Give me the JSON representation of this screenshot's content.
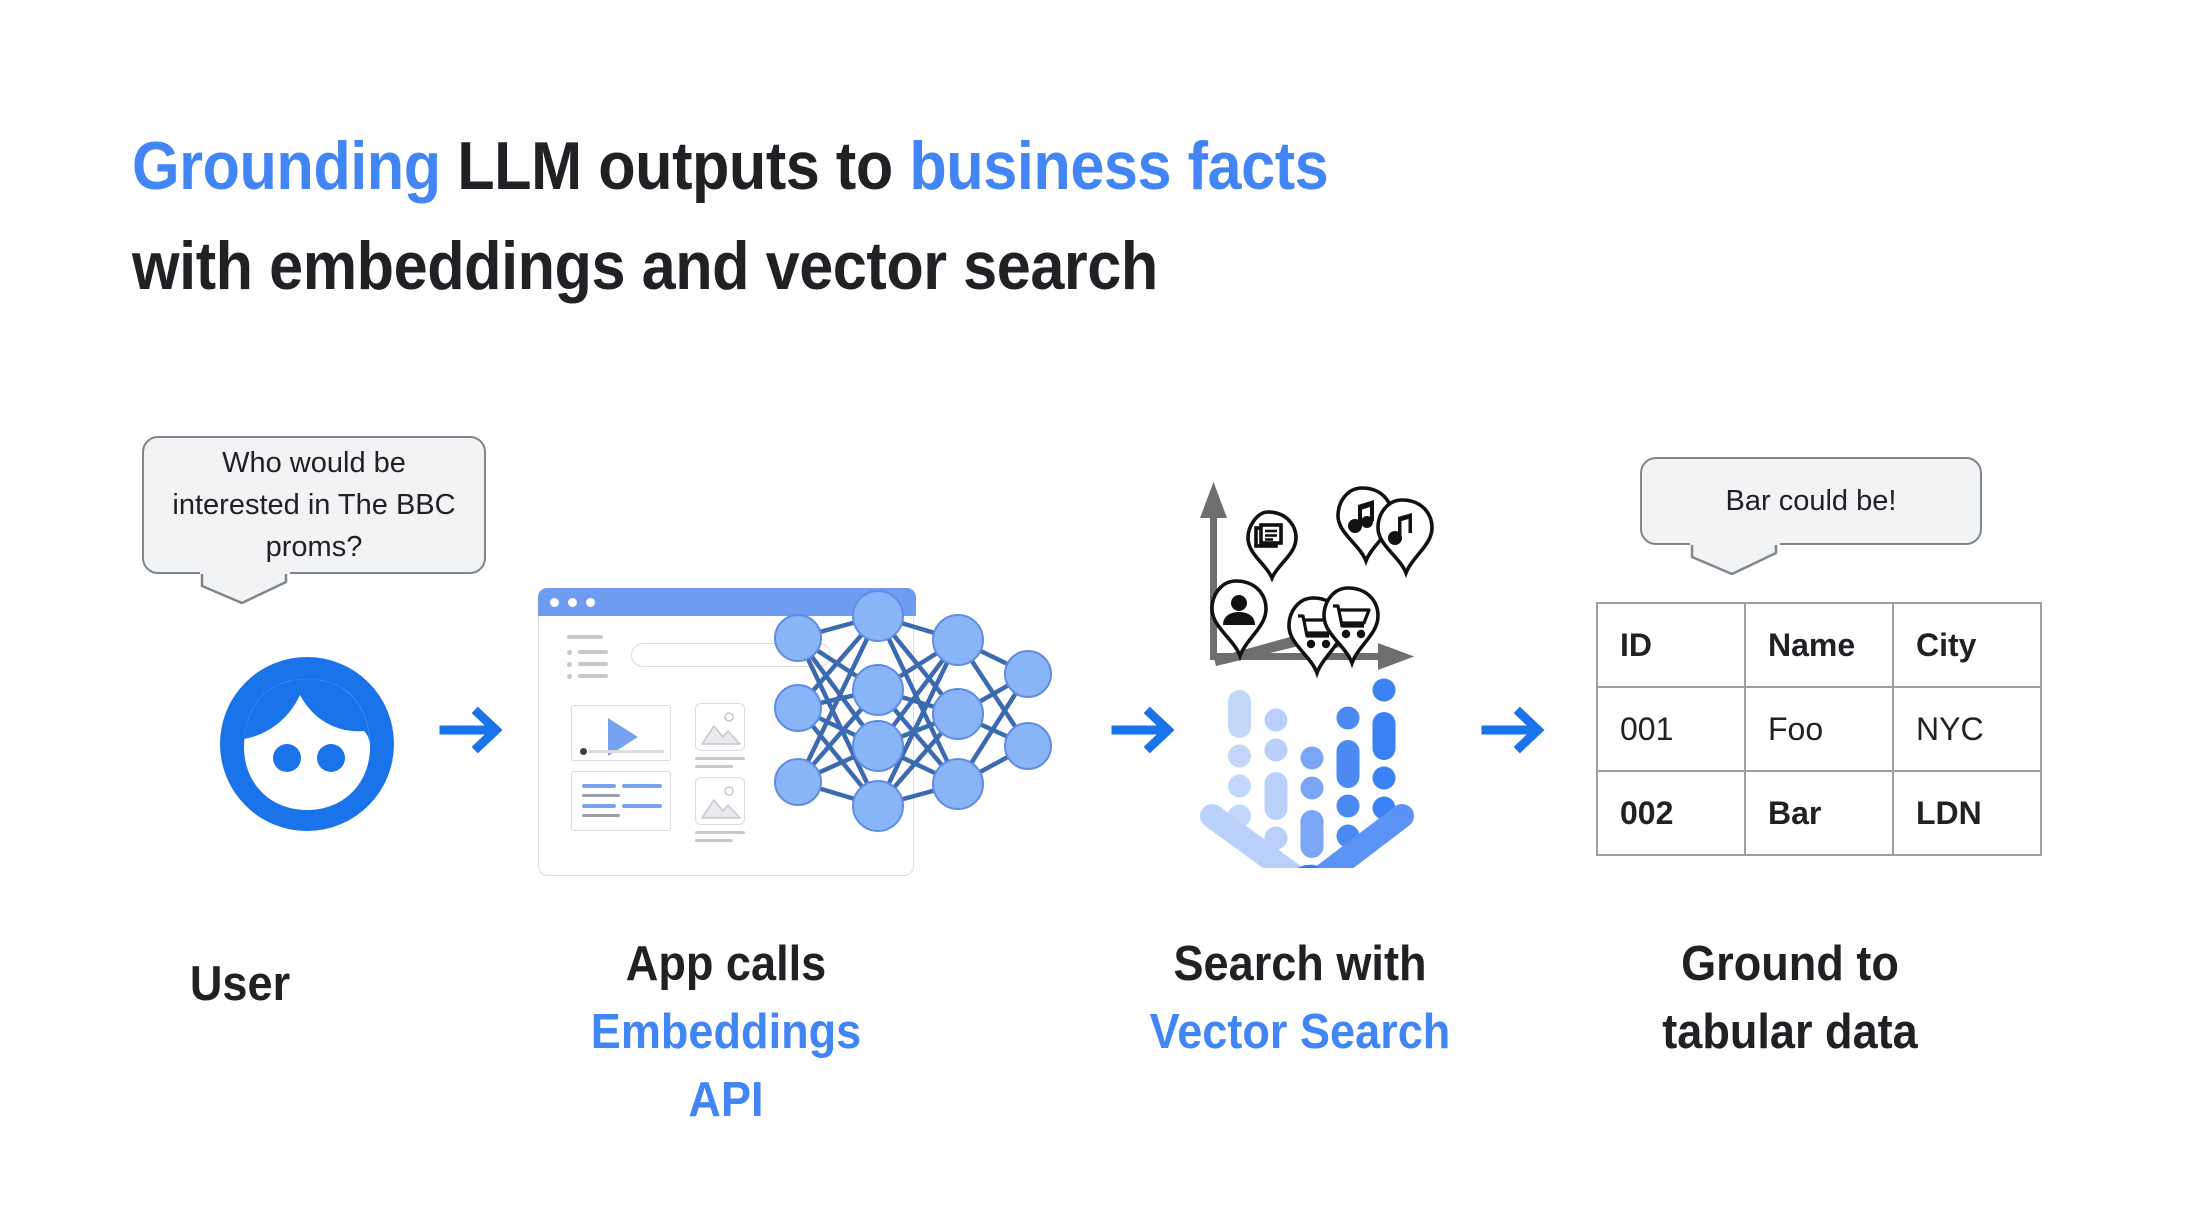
{
  "title": {
    "line1_part1": "Grounding",
    "line1_part2": "LLM outputs to",
    "line1_part3": "business facts",
    "line2": "with embeddings and vector search"
  },
  "flow": {
    "step1": {
      "bubble_text": "Who would be interested in The BBC proms?",
      "label_main": "User",
      "avatar_icon": "user-face-icon"
    },
    "step2": {
      "label_main": "App calls",
      "label_accent": "Embeddings API",
      "browser_icon": "app-window-icon",
      "network_icon": "neural-network-icon"
    },
    "step3": {
      "label_main": "Search with",
      "label_accent": "Vector Search",
      "axis_icon": "3d-axis-icon",
      "funnel_icon": "vector-funnel-icon",
      "pins": [
        "article-pin",
        "music-note-pin",
        "music-note-pin",
        "person-pin",
        "shopping-cart-pin",
        "shopping-cart-pin"
      ]
    },
    "step4": {
      "bubble_text": "Bar could be!",
      "label_main": "Ground to",
      "label_main2": "tabular data"
    },
    "arrow_icon": "arrow-right-icon"
  },
  "table": {
    "headers": [
      "ID",
      "Name",
      "City"
    ],
    "rows": [
      {
        "id": "001",
        "name": "Foo",
        "city": "NYC",
        "highlight": false
      },
      {
        "id": "002",
        "name": "Bar",
        "city": "LDN",
        "highlight": true
      }
    ]
  },
  "colors": {
    "accent_blue": "#4285F4",
    "arrow_blue": "#1a73e8",
    "node_blue": "#8ab4f8",
    "edge_blue": "#3b6ab0",
    "titlebar_blue": "#6f9cf0",
    "bubble_fill": "#f1f3f4",
    "bubble_border": "#80868b",
    "text_dark": "#202124",
    "grid_gray": "#9aa0a6",
    "axis_gray": "#6e6e6e"
  }
}
